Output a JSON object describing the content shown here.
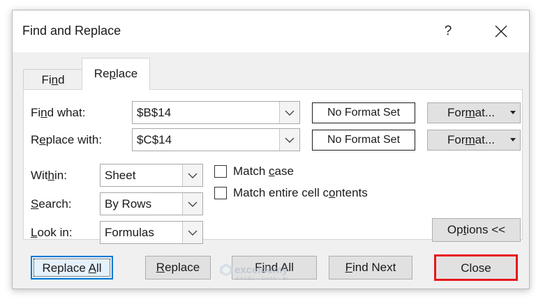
{
  "dialog": {
    "title": "Find and Replace",
    "help_label": "?"
  },
  "tabs": {
    "find": {
      "pre": "Fi",
      "u": "n",
      "post": "d"
    },
    "replace": {
      "pre": "Re",
      "u": "p",
      "post": "lace"
    }
  },
  "find_what": {
    "label_pre": "Fi",
    "label_u": "n",
    "label_post": "d what:",
    "value": "$B$14",
    "format_status": "No Format Set",
    "format_btn_pre": "For",
    "format_btn_u": "m",
    "format_btn_post": "at..."
  },
  "replace_with": {
    "label_pre": "R",
    "label_u": "e",
    "label_post": "place with:",
    "value": "$C$14",
    "format_status": "No Format Set",
    "format_btn_pre": "For",
    "format_btn_u": "m",
    "format_btn_post": "at..."
  },
  "options": {
    "within": {
      "label_pre": "Wit",
      "label_u": "h",
      "label_post": "in:",
      "value": "Sheet"
    },
    "search": {
      "label_pre": "",
      "label_u": "S",
      "label_post": "earch:",
      "value": "By Rows"
    },
    "look_in": {
      "label_pre": "",
      "label_u": "L",
      "label_post": "ook in:",
      "value": "Formulas"
    },
    "match_case": {
      "pre": "Match ",
      "u": "c",
      "post": "ase",
      "checked": false
    },
    "match_entire": {
      "pre": "Match entire cell c",
      "u": "o",
      "post": "ntents",
      "checked": false
    },
    "options_btn": {
      "pre": "Op",
      "u": "t",
      "post": "ions <<"
    }
  },
  "buttons": {
    "replace_all": {
      "pre": "Replace ",
      "u": "A",
      "post": "ll"
    },
    "replace": {
      "pre": "",
      "u": "R",
      "post": "eplace"
    },
    "find_all": {
      "pre": "F",
      "u": "i",
      "post": "nd All"
    },
    "find_next": {
      "pre": "",
      "u": "F",
      "post": "ind Next"
    },
    "close": "Close"
  },
  "watermark": {
    "name": "exceldemy",
    "tagline": "EXCEL · DATA · BI"
  },
  "colors": {
    "highlight_red": "#e8161b",
    "focus_blue": "#0078d7"
  }
}
